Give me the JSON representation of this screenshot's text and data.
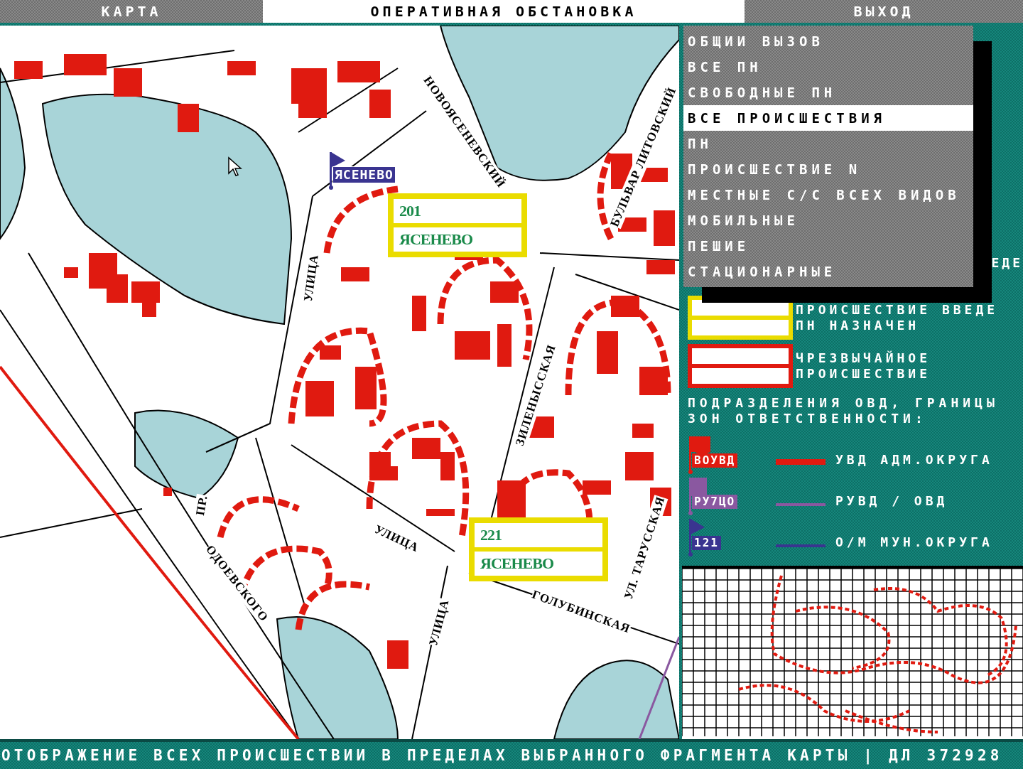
{
  "tabs": [
    {
      "label": "КАРТА",
      "selected": false
    },
    {
      "label": "ОПЕРАТИВНАЯ ОБСТАНОВКА",
      "selected": true
    },
    {
      "label": "ВЫХОД",
      "selected": false
    }
  ],
  "map": {
    "unit_flags": [
      {
        "label": "ЯСЕНЕВО",
        "kind": "municipal"
      }
    ],
    "incidents": [
      {
        "number": "201",
        "district": "ЯСЕНЕВО",
        "kind": "assigned"
      },
      {
        "number": "221",
        "district": "ЯСЕНЕВО",
        "kind": "assigned"
      }
    ],
    "street_labels": [
      "НОВОЯСЕНЕВСКИЙ",
      "БУЛЬВАР ЛИТОВСКИЙ",
      "УЛИЦА",
      "ЗИЛЕНЫССКАЯ",
      "УЛИЦА",
      "УЛИЦА",
      "ГОЛУБИНСКАЯ",
      "УЛ. ТАРУССКАЯ",
      "ОДОЕВСКОГО",
      "ПР."
    ]
  },
  "menu": {
    "items": [
      {
        "label": "ОБЩИИ ВЫЗОВ",
        "selected": false
      },
      {
        "label": "ВСЕ ПН",
        "selected": false
      },
      {
        "label": "СВОБОДНЫЕ ПН",
        "selected": false
      },
      {
        "label": "ВСЕ ПРОИСШЕСТВИЯ",
        "selected": true
      },
      {
        "label": "ПН",
        "selected": false
      },
      {
        "label": "ПРОИСШЕСТВИЕ N",
        "selected": false
      },
      {
        "label": "МЕСТНЫЕ С/С ВСЕХ ВИДОВ",
        "selected": false
      },
      {
        "label": "МОБИЛЬНЫЕ",
        "selected": false
      },
      {
        "label": "ПЕШИЕ",
        "selected": false
      },
      {
        "label": "СТАЦИОНАРНЫЕ",
        "selected": false
      }
    ]
  },
  "legend": {
    "covered_fragment": "ЕДЕ",
    "incident_types": [
      {
        "kind": "assigned",
        "lines": [
          "ПРОИСШЕСТВИЕ ВВЕДЕ",
          "ПН НАЗНАЧЕН"
        ]
      },
      {
        "kind": "emergency",
        "lines": [
          "ЧРЕЗВЫЧАЙНОЕ",
          "ПРОИСШЕСТВИЕ"
        ]
      }
    ],
    "units_heading": [
      "ПОДРАЗДЕЛЕНИЯ ОВД, ГРАНИЦЫ",
      "ЗОН ОТВЕТСТВЕННОСТИ:"
    ],
    "units": [
      {
        "badge": "ВОУВД",
        "kind": "okrug",
        "color": "#e01a10",
        "description": "УВД АДМ.ОКРУГА"
      },
      {
        "badge": "РУ7ЦО",
        "kind": "rayon",
        "color": "#8a58a0",
        "description": "РУВД / ОВД"
      },
      {
        "badge": "121",
        "kind": "municipal",
        "color": "#3a3490",
        "description": "О/М МУН.ОКРУГА"
      }
    ]
  },
  "status_bar": "ОТОБРАЖЕНИЕ ВСЕХ ПРОИСШЕСТВИИ В ПРЕДЕЛАХ ВЫБРАННОГО ФРАГМЕНТА КАРТЫ | ДЛ 372928"
}
